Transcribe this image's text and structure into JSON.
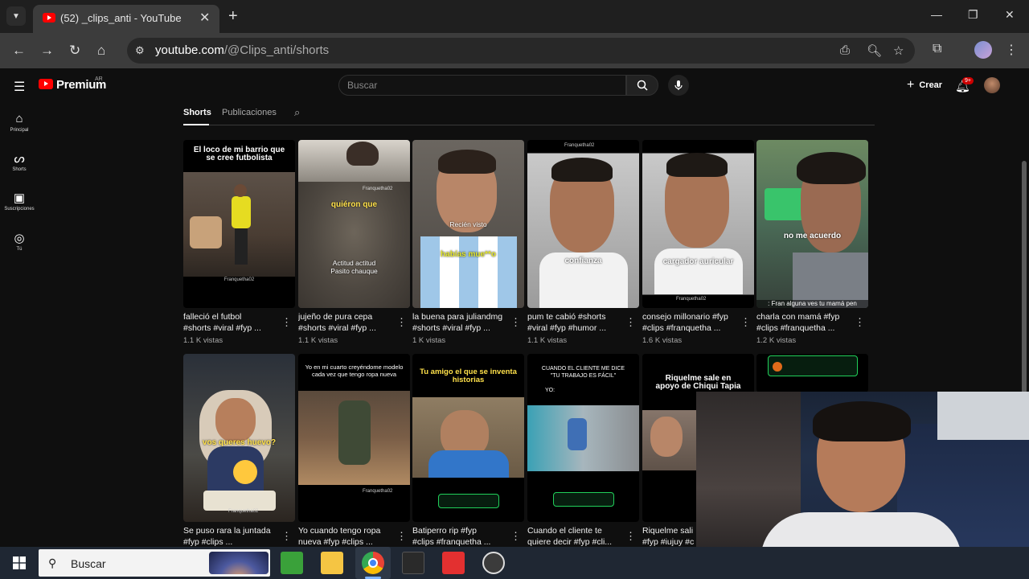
{
  "browser": {
    "tab_title": "(52) _clips_anti - YouTube",
    "url_host": "youtube.com",
    "url_path": "/@Clips_anti/shorts"
  },
  "youtube": {
    "brand": "Premium",
    "region": "AR",
    "search_placeholder": "Buscar",
    "create_label": "Crear",
    "notifications_badge": "9+"
  },
  "sidebar": {
    "items": [
      {
        "label": "Principal",
        "icon": "home-icon"
      },
      {
        "label": "Shorts",
        "icon": "shorts-icon"
      },
      {
        "label": "Suscripciones",
        "icon": "subscriptions-icon"
      },
      {
        "label": "Tú",
        "icon": "you-icon"
      }
    ]
  },
  "channel_tabs": [
    "Shorts",
    "Publicaciones"
  ],
  "shorts_row1": [
    {
      "caption": "El loco de mi barrio que se cree futbolista",
      "title1": "falleció el futbol",
      "title2": "#shorts #viral #fyp ...",
      "views": "1.1 K vistas"
    },
    {
      "caption": "quiéron que",
      "caption2": "Actitud actitud Pasito chauque",
      "title1": "jujeño de pura cepa",
      "title2": "#shorts #viral #fyp ...",
      "views": "1.1 K vistas"
    },
    {
      "caption": "Recién visto",
      "caption2": "habías mue**o",
      "title1": "la buena para juliandmg",
      "title2": "#shorts #viral #fyp ...",
      "views": "1 K vistas"
    },
    {
      "caption": "confianza",
      "title1": "pum te cabió #shorts",
      "title2": "#viral #fyp #humor ...",
      "views": "1.1 K vistas"
    },
    {
      "caption": "cargador auricular",
      "title1": "consejo millonario #fyp",
      "title2": "#clips #franquetha ...",
      "views": "1.6 K vistas"
    },
    {
      "caption": "no me acuerdo",
      "caption2": ": Fran alguna ves tu mamá pen",
      "title1": "charla con mamá #fyp",
      "title2": "#clips #franquetha ...",
      "views": "1.2 K vistas"
    }
  ],
  "shorts_row2": [
    {
      "caption": "vos queres huevo?",
      "title1": "Se puso rara la juntada",
      "title2": "#fyp #clips ..."
    },
    {
      "caption": "Yo en mi cuarto creyéndome modelo cada vez que tengo ropa nueva",
      "title1": "Yo cuando tengo ropa",
      "title2": "nueva #fyp #clips ..."
    },
    {
      "caption": "Tu amigo el que se inventa historias",
      "title1": "Batiperro rip #fyp",
      "title2": "#clips #franquetha ..."
    },
    {
      "caption": "CUANDO EL CLIENTE ME DICE \"TU TRABAJO ES FÁCIL\"",
      "caption2": "YO:",
      "title1": "Cuando el cliente te",
      "title2": "quiere decir #fyp #cli..."
    },
    {
      "caption": "Riquelme sale en apoyo de Chiqui Tapia",
      "title1": "Riquelme sali",
      "title2": "#fyp #iujuy #c"
    }
  ],
  "watermark": "Franquetha02",
  "taskbar": {
    "search_text": "Buscar",
    "apps": [
      "minecraft",
      "file-explorer",
      "chrome",
      "epic-games",
      "wps",
      "obs"
    ]
  }
}
